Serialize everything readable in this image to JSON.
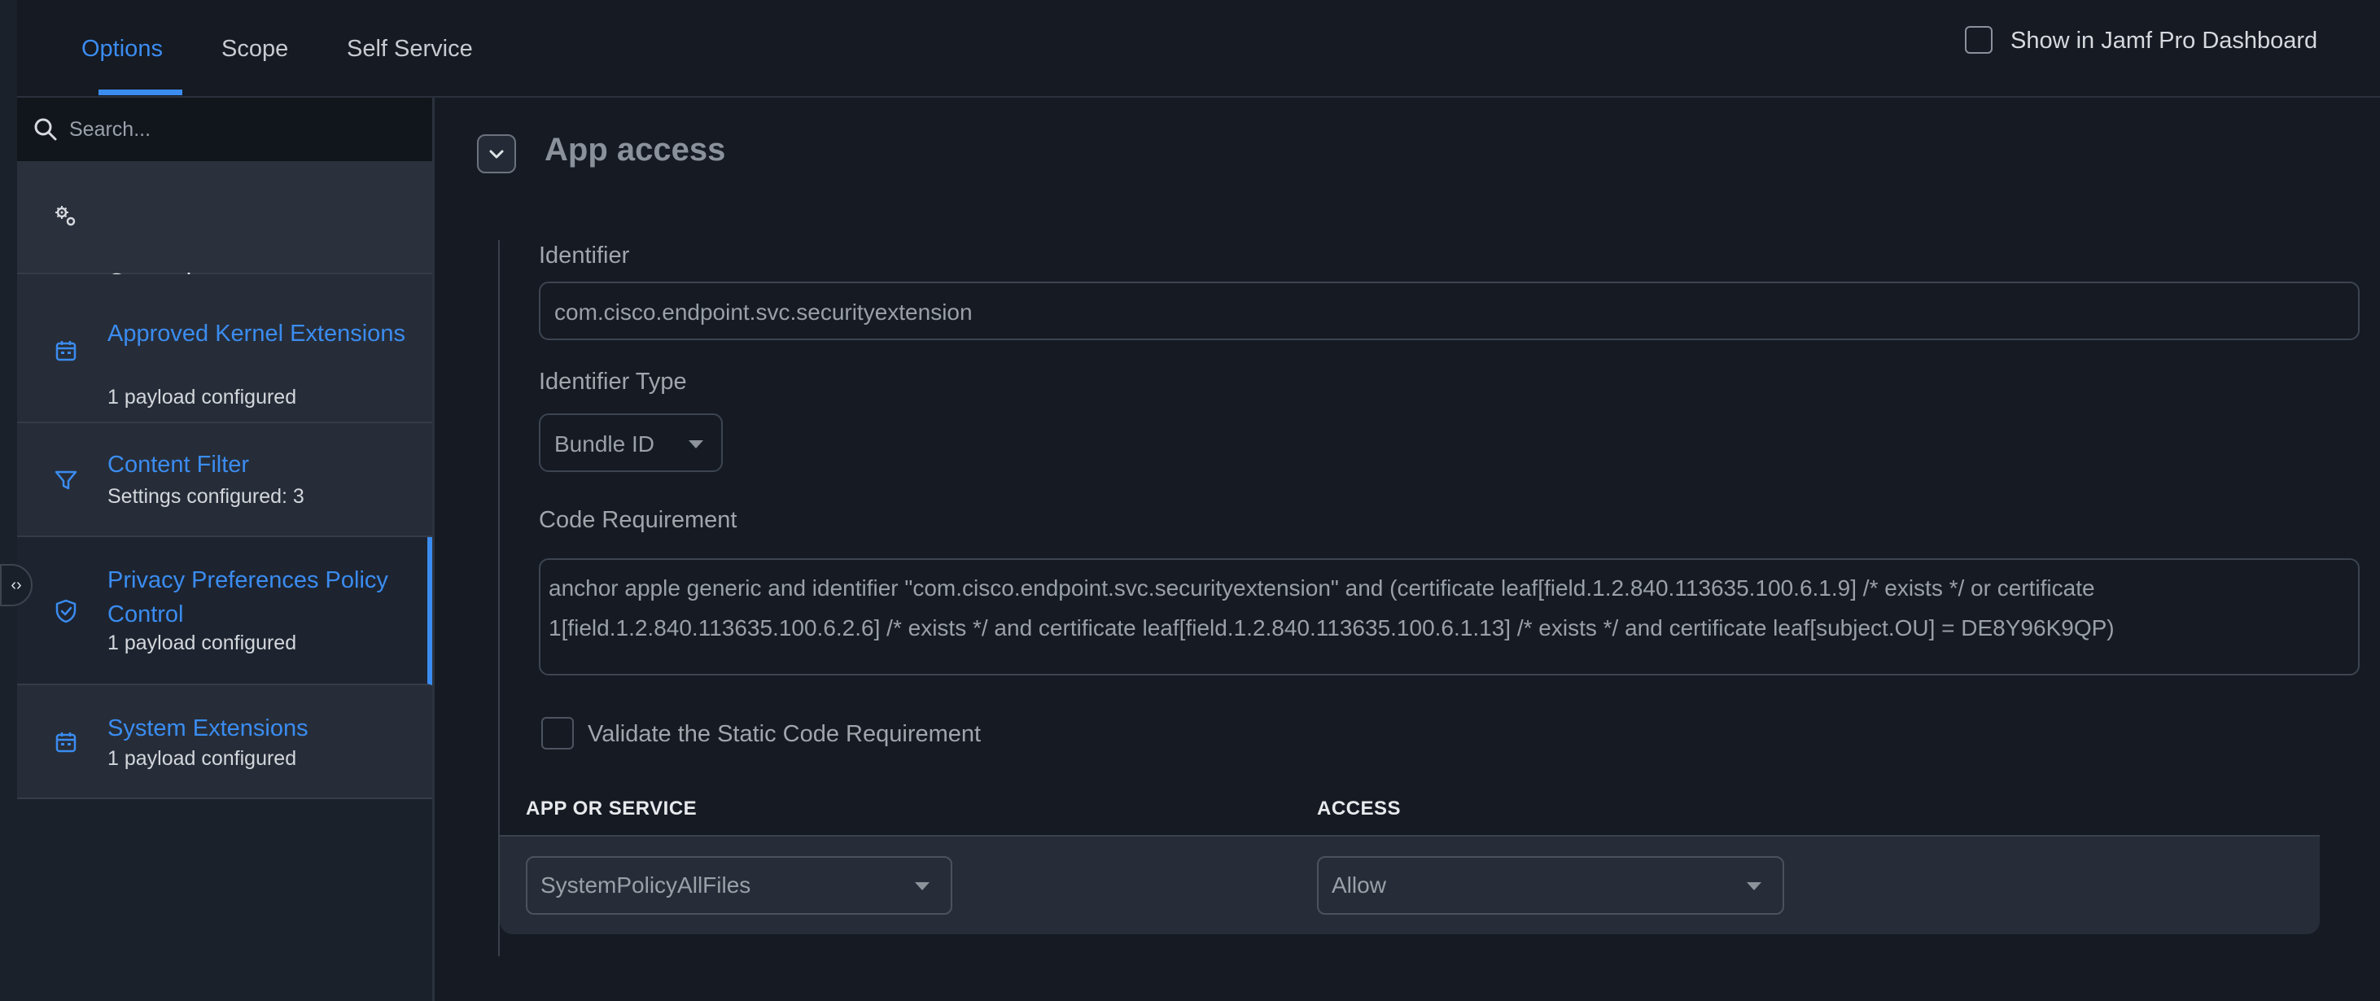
{
  "tabs": [
    "Options",
    "Scope",
    "Self Service"
  ],
  "dashboard_label": "Show in Jamf Pro Dashboard",
  "search": {
    "placeholder": "Search..."
  },
  "sidebar": {
    "items": [
      {
        "title": "General",
        "subtitle": "",
        "icon": "gears-icon"
      },
      {
        "title": "Approved Kernel Extensions",
        "subtitle": "1 payload configured",
        "icon": "calendar-icon"
      },
      {
        "title": "Content Filter",
        "subtitle": "Settings configured: 3",
        "icon": "filter-icon"
      },
      {
        "title": "Privacy Preferences Policy Control",
        "subtitle": "1 payload configured",
        "icon": "shield-icon"
      },
      {
        "title": "System Extensions",
        "subtitle": "1 payload configured",
        "icon": "calendar-icon"
      }
    ]
  },
  "main": {
    "section_title": "App access",
    "identifier_label": "Identifier",
    "identifier_value": "com.cisco.endpoint.svc.securityextension",
    "identifier_type_label": "Identifier Type",
    "identifier_type_value": "Bundle ID",
    "code_requirement_label": "Code Requirement",
    "code_requirement_value": "anchor apple generic and identifier \"com.cisco.endpoint.svc.securityextension\" and (certificate leaf[field.1.2.840.113635.100.6.1.9] /* exists */ or certificate 1[field.1.2.840.113635.100.6.2.6] /* exists */ and certificate leaf[field.1.2.840.113635.100.6.1.13] /* exists */ and certificate leaf[subject.OU] = DE8Y96K9QP)",
    "validate_label": "Validate the Static Code Requirement",
    "table": {
      "headers": [
        "APP OR SERVICE",
        "ACCESS"
      ],
      "rows": [
        {
          "service": "SystemPolicyAllFiles",
          "access": "Allow"
        }
      ]
    }
  },
  "colors": {
    "accent": "#3b8cf0",
    "background": "#151a23",
    "sidebar": "#262d38"
  }
}
